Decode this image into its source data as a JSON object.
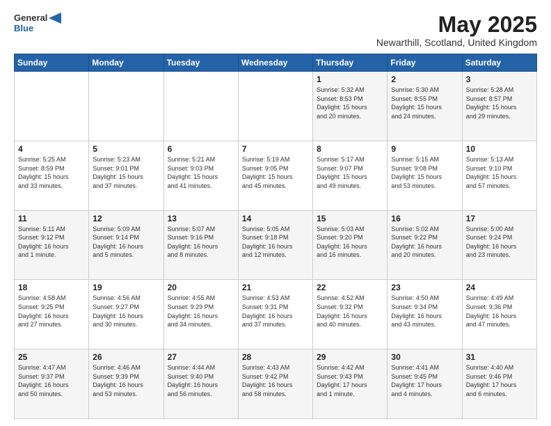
{
  "header": {
    "logo_general": "General",
    "logo_blue": "Blue",
    "title": "May 2025",
    "subtitle": "Newarthill, Scotland, United Kingdom"
  },
  "days_of_week": [
    "Sunday",
    "Monday",
    "Tuesday",
    "Wednesday",
    "Thursday",
    "Friday",
    "Saturday"
  ],
  "weeks": [
    [
      {
        "day": "",
        "info": ""
      },
      {
        "day": "",
        "info": ""
      },
      {
        "day": "",
        "info": ""
      },
      {
        "day": "",
        "info": ""
      },
      {
        "day": "1",
        "info": "Sunrise: 5:32 AM\nSunset: 8:53 PM\nDaylight: 15 hours\nand 20 minutes."
      },
      {
        "day": "2",
        "info": "Sunrise: 5:30 AM\nSunset: 8:55 PM\nDaylight: 15 hours\nand 24 minutes."
      },
      {
        "day": "3",
        "info": "Sunrise: 5:28 AM\nSunset: 8:57 PM\nDaylight: 15 hours\nand 29 minutes."
      }
    ],
    [
      {
        "day": "4",
        "info": "Sunrise: 5:25 AM\nSunset: 8:59 PM\nDaylight: 15 hours\nand 33 minutes."
      },
      {
        "day": "5",
        "info": "Sunrise: 5:23 AM\nSunset: 9:01 PM\nDaylight: 15 hours\nand 37 minutes."
      },
      {
        "day": "6",
        "info": "Sunrise: 5:21 AM\nSunset: 9:03 PM\nDaylight: 15 hours\nand 41 minutes."
      },
      {
        "day": "7",
        "info": "Sunrise: 5:19 AM\nSunset: 9:05 PM\nDaylight: 15 hours\nand 45 minutes."
      },
      {
        "day": "8",
        "info": "Sunrise: 5:17 AM\nSunset: 9:07 PM\nDaylight: 15 hours\nand 49 minutes."
      },
      {
        "day": "9",
        "info": "Sunrise: 5:15 AM\nSunset: 9:08 PM\nDaylight: 15 hours\nand 53 minutes."
      },
      {
        "day": "10",
        "info": "Sunrise: 5:13 AM\nSunset: 9:10 PM\nDaylight: 15 hours\nand 57 minutes."
      }
    ],
    [
      {
        "day": "11",
        "info": "Sunrise: 5:11 AM\nSunset: 9:12 PM\nDaylight: 16 hours\nand 1 minute."
      },
      {
        "day": "12",
        "info": "Sunrise: 5:09 AM\nSunset: 9:14 PM\nDaylight: 16 hours\nand 5 minutes."
      },
      {
        "day": "13",
        "info": "Sunrise: 5:07 AM\nSunset: 9:16 PM\nDaylight: 16 hours\nand 8 minutes."
      },
      {
        "day": "14",
        "info": "Sunrise: 5:05 AM\nSunset: 9:18 PM\nDaylight: 16 hours\nand 12 minutes."
      },
      {
        "day": "15",
        "info": "Sunrise: 5:03 AM\nSunset: 9:20 PM\nDaylight: 16 hours\nand 16 minutes."
      },
      {
        "day": "16",
        "info": "Sunrise: 5:02 AM\nSunset: 9:22 PM\nDaylight: 16 hours\nand 20 minutes."
      },
      {
        "day": "17",
        "info": "Sunrise: 5:00 AM\nSunset: 9:24 PM\nDaylight: 16 hours\nand 23 minutes."
      }
    ],
    [
      {
        "day": "18",
        "info": "Sunrise: 4:58 AM\nSunset: 9:25 PM\nDaylight: 16 hours\nand 27 minutes."
      },
      {
        "day": "19",
        "info": "Sunrise: 4:56 AM\nSunset: 9:27 PM\nDaylight: 16 hours\nand 30 minutes."
      },
      {
        "day": "20",
        "info": "Sunrise: 4:55 AM\nSunset: 9:29 PM\nDaylight: 16 hours\nand 34 minutes."
      },
      {
        "day": "21",
        "info": "Sunrise: 4:53 AM\nSunset: 9:31 PM\nDaylight: 16 hours\nand 37 minutes."
      },
      {
        "day": "22",
        "info": "Sunrise: 4:52 AM\nSunset: 9:32 PM\nDaylight: 16 hours\nand 40 minutes."
      },
      {
        "day": "23",
        "info": "Sunrise: 4:50 AM\nSunset: 9:34 PM\nDaylight: 16 hours\nand 43 minutes."
      },
      {
        "day": "24",
        "info": "Sunrise: 4:49 AM\nSunset: 9:36 PM\nDaylight: 16 hours\nand 47 minutes."
      }
    ],
    [
      {
        "day": "25",
        "info": "Sunrise: 4:47 AM\nSunset: 9:37 PM\nDaylight: 16 hours\nand 50 minutes."
      },
      {
        "day": "26",
        "info": "Sunrise: 4:46 AM\nSunset: 9:39 PM\nDaylight: 16 hours\nand 53 minutes."
      },
      {
        "day": "27",
        "info": "Sunrise: 4:44 AM\nSunset: 9:40 PM\nDaylight: 16 hours\nand 56 minutes."
      },
      {
        "day": "28",
        "info": "Sunrise: 4:43 AM\nSunset: 9:42 PM\nDaylight: 16 hours\nand 58 minutes."
      },
      {
        "day": "29",
        "info": "Sunrise: 4:42 AM\nSunset: 9:43 PM\nDaylight: 17 hours\nand 1 minute."
      },
      {
        "day": "30",
        "info": "Sunrise: 4:41 AM\nSunset: 9:45 PM\nDaylight: 17 hours\nand 4 minutes."
      },
      {
        "day": "31",
        "info": "Sunrise: 4:40 AM\nSunset: 9:46 PM\nDaylight: 17 hours\nand 6 minutes."
      }
    ]
  ]
}
